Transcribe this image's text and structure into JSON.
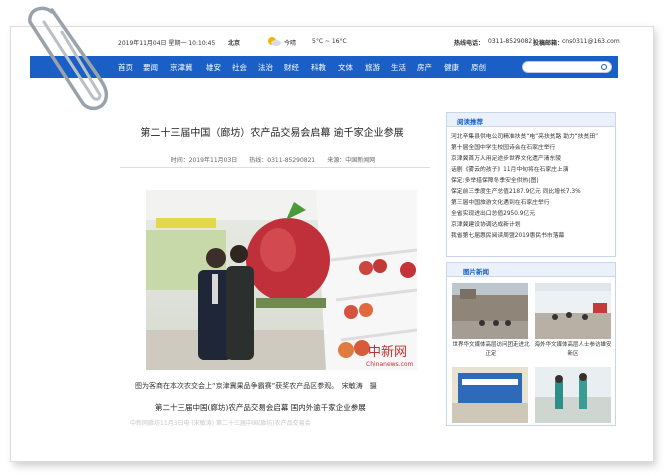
{
  "topbar": {
    "datetime": "2019年11月04日 星期一 10:10:45",
    "city": "北京",
    "weather": "今晴",
    "temp": "5°C ~ 16°C",
    "hotline_label": "热线电话：",
    "hotline": "0311-85290821",
    "email_label": "投稿邮箱：",
    "email": "cns0311@163.com"
  },
  "nav": {
    "items": [
      "首页",
      "要闻",
      "京津冀",
      "雄安",
      "社会",
      "法治",
      "财经",
      "科教",
      "文体",
      "旅游",
      "生活",
      "房产",
      "健康",
      "原创"
    ],
    "search_placeholder": ""
  },
  "article": {
    "title": "第二十三届中国（廊坊）农产品交易会启幕 逾千家企业参展",
    "meta": "时间：2019年11月03日　　热线：0311-85290821　　来源：中国新闻网",
    "caption": "图为客商在本次农交会上“京津冀果品争霸赛”获奖农产品区参观。　宋敏涛　摄",
    "subhead": "第二十三届中国(廊坊)农产品交易会启幕 国内外逾千家企业参展",
    "faded_text": "中新网廊坊11月3日电 (宋敏涛) 第二十三届中国(廊坊)农产品交易会"
  },
  "photo": {
    "watermark": "中新网",
    "watermark_url": "Chinanews.com"
  },
  "sidebar": {
    "recommend_title": "阅读推荐",
    "recommend": [
      "河北辛集县供电公司精准扶贫“电”亮扶贫路 助力“扶贫田”",
      "第十届全国中学生校园诗会在石家庄举行",
      "京津冀首万人用足途步世界文化遗产清东陵",
      "话剧《雾云的孩子》11月中旬将在石家庄上演",
      "保定:多举措保障冬季安全供热(图)",
      "保定前三季度生产总值2187.9亿元 同比增长7.3%",
      "第三届中国旅游文化遇到在石家庄举行",
      "全省实现进出口总值2950.9亿元",
      "京津冀建设协调达成新计划",
      "我省第七届惠民阅读周暨2019惠民书市落幕"
    ],
    "pics_title": "图片新闻",
    "pics": [
      {
        "caption": "世界华文媒体高层访问团走进北正定"
      },
      {
        "caption": "海外华文媒体高层人士参访雄安新区"
      },
      {
        "caption": ""
      },
      {
        "caption": ""
      }
    ]
  },
  "colors": {
    "nav": "#1a5fc6",
    "accent": "#1a5fc6"
  }
}
